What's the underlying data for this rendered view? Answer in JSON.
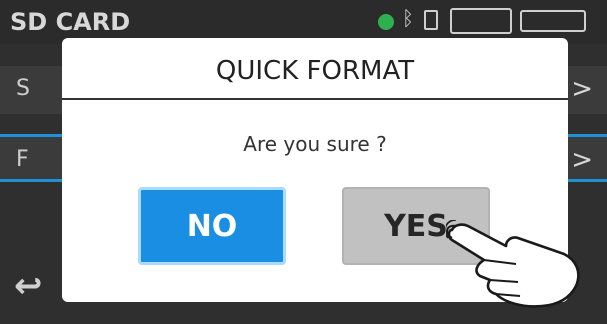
{
  "status_bar": {
    "title": "SD CARD",
    "indicator_color": "#2fb04e",
    "bluetooth_icon": "ᛒ"
  },
  "menu": {
    "items": [
      {
        "letter": "S",
        "chevron": ">"
      },
      {
        "letter": "F",
        "chevron": ">"
      }
    ],
    "back_icon": "↩"
  },
  "dialog": {
    "title": "QUICK FORMAT",
    "message": "Are you sure ?",
    "buttons": {
      "no": "NO",
      "yes": "YES"
    }
  },
  "colors": {
    "accent_blue": "#1a8ee3",
    "yes_gray": "#c1c1c1",
    "dialog_bg": "#ffffff",
    "screen_bg": "#2f2f2f"
  }
}
